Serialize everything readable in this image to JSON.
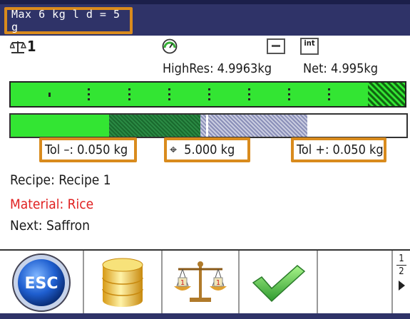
{
  "header": {
    "capacity_text": "Max 6 kg  l d = 5 g"
  },
  "status": {
    "scale_label": "1"
  },
  "readings": {
    "highres": "HighRes: 4.9963kg",
    "net": "Net: 4.995kg"
  },
  "tolerance": {
    "minus": "Tol –: 0.050 kg",
    "target": "5.000 kg",
    "plus": "Tol +: 0.050 kg"
  },
  "recipe": {
    "recipe_line": "Recipe: Recipe 1",
    "material_line": "Material: Rice",
    "next_line": "Next: Saffron"
  },
  "pager": {
    "current": "1",
    "total": "2"
  },
  "colors": {
    "header_bg": "#2f3368",
    "highlight": "#d98b1d",
    "bar_green": "#33e533",
    "material_red": "#e02020"
  },
  "icons": [
    "scale-icon",
    "speedometer-icon",
    "minus-box-icon",
    "int-box-icon",
    "target-icon",
    "esc-icon",
    "database-icon",
    "balance-icon",
    "checkmark-icon",
    "arrow-right-icon"
  ]
}
